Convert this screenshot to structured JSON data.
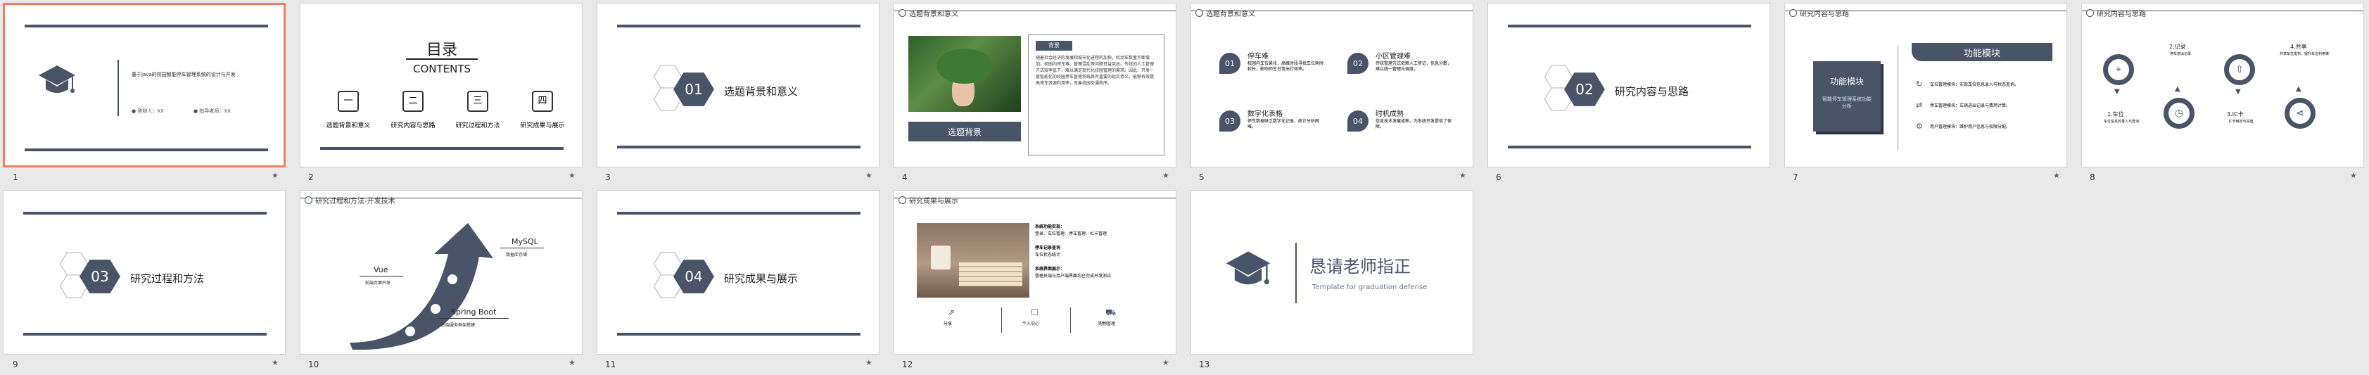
{
  "slide_numbers": [
    "1",
    "2",
    "3",
    "4",
    "5",
    "6",
    "7",
    "8",
    "9",
    "10",
    "11",
    "12",
    "13"
  ],
  "star_glyph": "★",
  "s1": {
    "title": "基于Java的校园智能停车管理系统的设计与开发",
    "student": "答辩人：XX",
    "teacher": "指导老师：XX"
  },
  "s2": {
    "title": "目录",
    "subtitle": "CONTENTS",
    "items": [
      {
        "num": "一",
        "label": "选题背景和意义"
      },
      {
        "num": "二",
        "label": "研究内容与思路"
      },
      {
        "num": "三",
        "label": "研究过程和方法"
      },
      {
        "num": "四",
        "label": "研究成果与展示"
      }
    ]
  },
  "s3": {
    "num": "01",
    "title": "选题背景和意义"
  },
  "s4": {
    "header": "选题背景和意义",
    "box_title": "背景",
    "body": "随着社会经济的发展和城市化进程的加快，机动车数量不断增加，校园内停车难、管理混乱等问题日益突出。传统的人工管理方式效率低下，难以满足现代化校园管理的需求。因此，开发一套智能化的校园停车管理系统具有重要的现实意义，能够有效提高停车资源利用率，改善校园交通秩序。",
    "caption": "选题背景"
  },
  "s5": {
    "header": "选题背景和意义",
    "items": [
      {
        "num": "01",
        "title": "停车难",
        "text": "校园内车位紧张，高峰时段寻找车位耗时较长，影响师生日常出行效率。"
      },
      {
        "num": "02",
        "title": "小区管理难",
        "text": "传统管理方式依赖人工登记，信息分散，难以统一管理与调度。"
      },
      {
        "num": "03",
        "title": "数字化表格",
        "text": "停车数据缺乏数字化记录，统计分析困难。"
      },
      {
        "num": "04",
        "title": "时机成熟",
        "text": "信息技术发展成熟，为系统开发提供了保障。"
      }
    ]
  },
  "s6": {
    "num": "02",
    "title": "研究内容与思路"
  },
  "s7": {
    "header": "研究内容与思路",
    "left_title": "功能模块",
    "left_text": "智能停车管理系统功能分析",
    "right_title": "功能模块",
    "items": [
      "车位管理模块：实现车位信息录入与状态查询。",
      "停车管理模块：车辆进出记录与费用计算。",
      "用户管理模块：维护用户信息与权限分配。"
    ]
  },
  "s8": {
    "header": "研究内容与思路",
    "items": [
      {
        "title": "1.车位",
        "text": "车位信息的录入与查询"
      },
      {
        "title": "2.记录",
        "text": "停车进出记录"
      },
      {
        "title": "3.IC卡",
        "text": "IC卡绑定与充值"
      },
      {
        "title": "4.共享",
        "text": "共享车位发布，提升车位利用率"
      }
    ]
  },
  "s9": {
    "num": "03",
    "title": "研究过程和方法"
  },
  "s10": {
    "header": "研究过程和方法-开发技术",
    "vue": "Vue",
    "vue_desc": "前端页面开发",
    "mysql": "MySQL",
    "mysql_desc": "数据库存储",
    "spring": "Spring Boot",
    "spring_desc": "后端服务框架搭建"
  },
  "s11": {
    "num": "04",
    "title": "研究成果与展示"
  },
  "s12": {
    "header": "研究成果与展示",
    "lines": [
      "系统功能实现：",
      "登录、车位管理、停车管理、IC卡管理",
      "停车记录查询",
      "车位状态统计",
      "系统界面展示：",
      "管理员端与用户端界面均已完成开发测试"
    ],
    "icons": [
      {
        "label": "分享"
      },
      {
        "label": "个人中心"
      },
      {
        "label": "购物管理"
      }
    ]
  },
  "s13": {
    "title": "恳请老师指正",
    "subtitle": "Template for graduation defense"
  },
  "colors": {
    "navy": "#4a5468",
    "selected_border": "#f07d63",
    "background": "#e9e9e9"
  }
}
